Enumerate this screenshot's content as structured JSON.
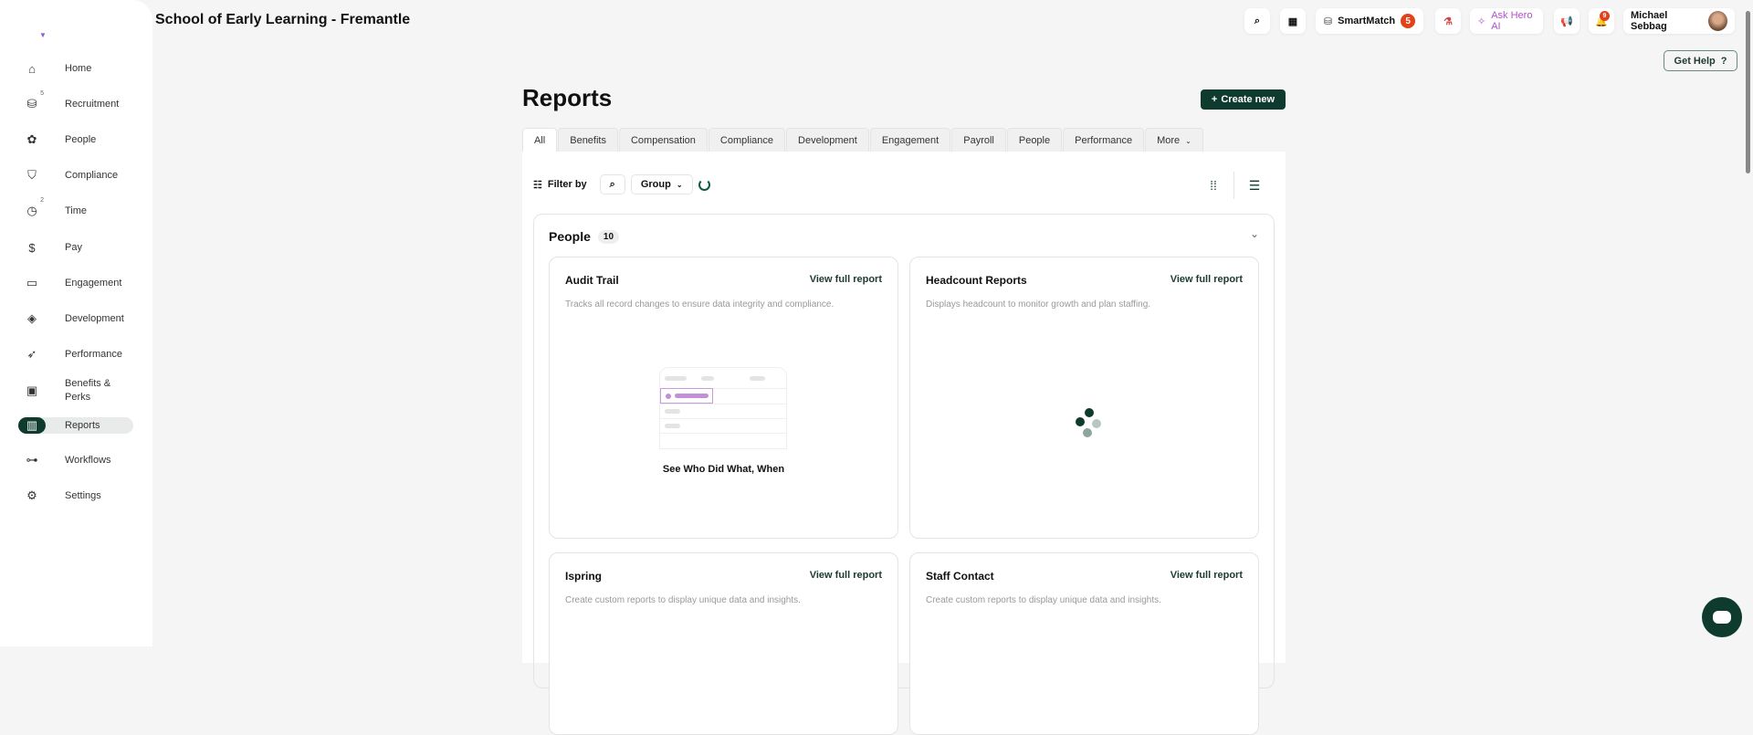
{
  "header": {
    "title": "School of Early Learning - Fremantle",
    "smartmatch_label": "SmartMatch",
    "smartmatch_count": "5",
    "ask_ai_label": "Ask Hero AI",
    "notification_count": "9",
    "user_name": "Michael Sebbag",
    "get_help_label": "Get Help",
    "get_help_icon": "?"
  },
  "sidebar": {
    "items": [
      {
        "label": "Home",
        "icon": "⌂"
      },
      {
        "label": "Recruitment",
        "icon": "⛁",
        "badge": "5"
      },
      {
        "label": "People",
        "icon": "✿"
      },
      {
        "label": "Compliance",
        "icon": "⛉"
      },
      {
        "label": "Time",
        "icon": "◷",
        "badge": "2"
      },
      {
        "label": "Pay",
        "icon": "$"
      },
      {
        "label": "Engagement",
        "icon": "▭"
      },
      {
        "label": "Development",
        "icon": "◈"
      },
      {
        "label": "Performance",
        "icon": "➶"
      },
      {
        "label": "Benefits & Perks",
        "icon": "▣"
      },
      {
        "label": "Reports",
        "icon": "▥"
      },
      {
        "label": "Workflows",
        "icon": "⊶"
      },
      {
        "label": "Settings",
        "icon": "⚙"
      }
    ]
  },
  "main": {
    "title": "Reports",
    "create_label": "Create new",
    "tabs": [
      "All",
      "Benefits",
      "Compensation",
      "Compliance",
      "Development",
      "Engagement",
      "Payroll",
      "People",
      "Performance",
      "More"
    ],
    "filter_label": "Filter by",
    "group_label": "Group",
    "group": {
      "name": "People",
      "count": "10"
    },
    "cards": [
      {
        "title": "Audit Trail",
        "link": "View full report",
        "description": "Tracks all record changes to ensure data integrity and compliance.",
        "caption": "See Who Did What, When"
      },
      {
        "title": "Headcount Reports",
        "link": "View full report",
        "description": "Displays headcount to monitor growth and plan staffing."
      },
      {
        "title": "Ispring",
        "link": "View full report",
        "description": "Create custom reports to display unique data and insights."
      },
      {
        "title": "Staff Contact",
        "link": "View full report",
        "description": "Create custom reports to display unique data and insights."
      }
    ]
  },
  "colors": {
    "brand": "#0e3b2e",
    "badge": "#e2411a",
    "ai": "#b052c9"
  }
}
